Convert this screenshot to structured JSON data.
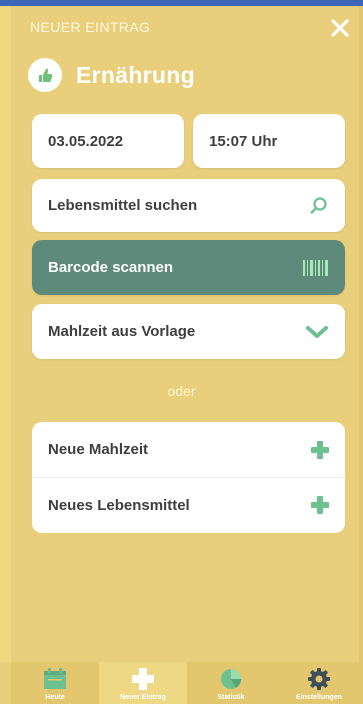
{
  "header": {
    "eyebrow": "NEUER EINTRAG",
    "title": "Ernährung"
  },
  "entry": {
    "date": "03.05.2022",
    "time": "15:07 Uhr"
  },
  "actions": {
    "search_label": "Lebensmittel suchen",
    "barcode_label": "Barcode scannen",
    "template_label": "Mahlzeit aus Vorlage"
  },
  "divider_text": "oder",
  "create": {
    "meal_label": "Neue Mahlzeit",
    "food_label": "Neues Lebensmittel"
  },
  "nav": {
    "items": [
      {
        "label": "Heute",
        "icon": "calendar-icon",
        "active": false
      },
      {
        "label": "Neuer Eintrag",
        "icon": "plus-icon",
        "active": true
      },
      {
        "label": "Statistik",
        "icon": "pie-chart-icon",
        "active": false
      },
      {
        "label": "Einstellungen",
        "icon": "gear-icon",
        "active": false
      }
    ]
  },
  "colors": {
    "background": "#e9cf7c",
    "accent_green": "#6fc08f",
    "barcode_button": "#5d8a7a",
    "nav_bar": "#e3c76f"
  }
}
